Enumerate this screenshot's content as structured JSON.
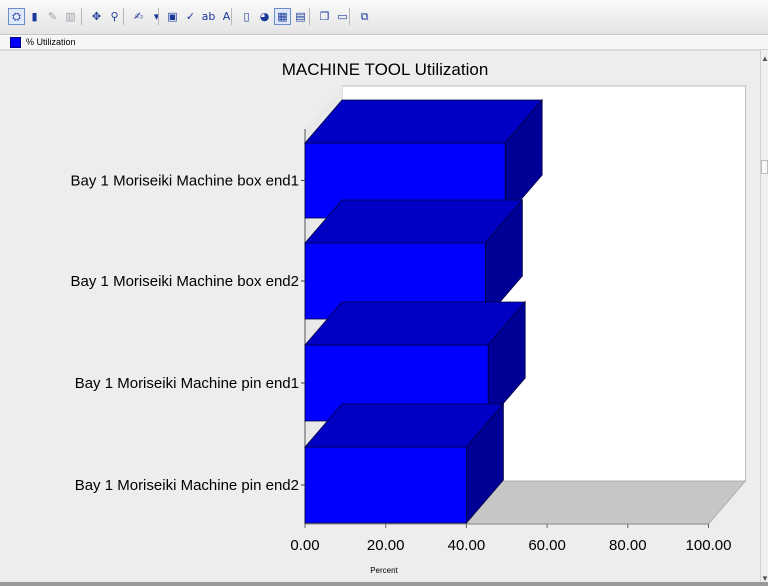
{
  "toolbar": {
    "buttons": [
      {
        "name": "binoculars-icon",
        "glyph": "⛭"
      },
      {
        "name": "bar-chart-color-icon",
        "glyph": "▮"
      },
      {
        "name": "edit-chart-icon",
        "glyph": "✎"
      },
      {
        "name": "bar-chart-gray-icon",
        "glyph": "▥"
      },
      {
        "name": "rotate-icon",
        "glyph": "✥"
      },
      {
        "name": "zoom-icon",
        "glyph": "⚲"
      },
      {
        "name": "paint-icon",
        "glyph": "✍"
      },
      {
        "name": "dropdown-arrow-icon",
        "glyph": "▾"
      },
      {
        "name": "window-icon",
        "glyph": "▣"
      },
      {
        "name": "check-chart-icon",
        "glyph": "✓"
      },
      {
        "name": "text-label-icon",
        "glyph": "ab"
      },
      {
        "name": "font-icon",
        "glyph": "A"
      },
      {
        "name": "bar-3d-icon",
        "glyph": "▯"
      },
      {
        "name": "pie-icon",
        "glyph": "◕"
      },
      {
        "name": "data-grid-icon",
        "glyph": "▦"
      },
      {
        "name": "legend-icon",
        "glyph": "▤"
      },
      {
        "name": "copy-icon",
        "glyph": "❐"
      },
      {
        "name": "save-icon",
        "glyph": "▭"
      },
      {
        "name": "export-icon",
        "glyph": "⧉"
      }
    ]
  },
  "legend": {
    "label": "% Utilization",
    "color": "#0000ff"
  },
  "chart_data": {
    "type": "bar",
    "orientation": "horizontal",
    "style": "3d",
    "title": "MACHINE TOOL Utilization",
    "xlabel": "Percent",
    "ylabel": "",
    "categories": [
      "Bay 1 Moriseiki Machine box end1",
      "Bay 1 Moriseiki Machine box end2",
      "Bay 1 Moriseiki Machine pin end1",
      "Bay 1 Moriseiki Machine pin end2"
    ],
    "series": [
      {
        "name": "% Utilization",
        "values": [
          49.6,
          44.7,
          45.4,
          40.0
        ],
        "color": "#0000ff"
      }
    ],
    "xlim": [
      0,
      100
    ],
    "xticks": [
      "0.00",
      "20.00",
      "40.00",
      "60.00",
      "80.00",
      "100.00"
    ],
    "grid": false,
    "legend_position": "top-left",
    "colors": {
      "bar_front": "#0000ff",
      "bar_top": "#0000c4",
      "bar_side": "#000096",
      "floor": "#c6c6c6",
      "plot_bg": "#ffffff",
      "panel_bg": "#ededed"
    }
  }
}
